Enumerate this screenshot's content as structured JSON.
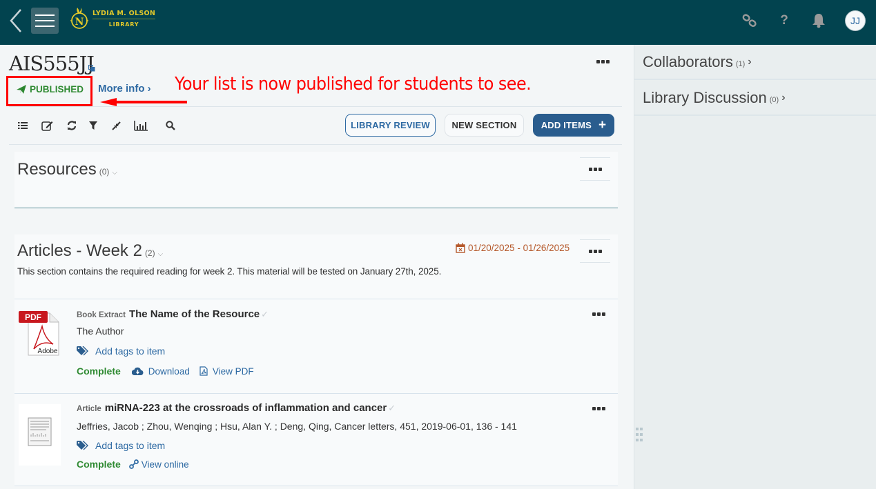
{
  "topbar": {
    "logo": {
      "line1": "LYDIA M. OLSON",
      "line2": "LIBRARY"
    },
    "icons": [
      "back-icon",
      "hamburger-menu-icon",
      "link-icon",
      "help-icon",
      "bell-icon"
    ],
    "avatar_initials": "JJ",
    "help_glyph": "?"
  },
  "list": {
    "title": "AIS555JJ",
    "status": "PUBLISHED",
    "more_info": "More info",
    "more_info_chevron": "›",
    "annotation": "Your list is now published for students to see."
  },
  "toolbar": {
    "icons": [
      "list-view-icon",
      "edit-icon",
      "refresh-icon",
      "filter-icon",
      "collapse-icon",
      "analytics-icon",
      "search-icon"
    ],
    "library_review": "LIBRARY REVIEW",
    "new_section": "NEW SECTION",
    "add_items": "ADD ITEMS",
    "add_items_icon": "+"
  },
  "sections": [
    {
      "title": "Resources",
      "count": "(0)",
      "chevron": "⌵"
    },
    {
      "title": "Articles - Week 2",
      "count": "(2)",
      "chevron": "⌵",
      "date_range": "01/20/2025 - 01/26/2025",
      "description": "This section contains the required reading for week 2. This material will be tested on January 27th, 2025.",
      "items": [
        {
          "type": "Book Extract",
          "title": "The Name of the Resource",
          "author": "The Author",
          "tags_label": "Add tags to item",
          "status": "Complete",
          "actions": [
            "Download",
            "View PDF"
          ],
          "thumb_label": "PDF",
          "thumb_brand": "Adobe"
        },
        {
          "type": "Article",
          "title": "miRNA-223 at the crossroads of inflammation and cancer",
          "citation": "Jeffries, Jacob ; Zhou, Wenqing ; Hsu, Alan Y. ; Deng, Qing, Cancer letters, 451, 2019-06-01, 136 - 141",
          "tags_label": "Add tags to item",
          "status": "Complete",
          "actions": [
            "View online"
          ]
        }
      ]
    }
  ],
  "sidebar": {
    "items": [
      {
        "label": "Collaborators",
        "count": "(1)",
        "chevron": "›"
      },
      {
        "label": "Library Discussion",
        "count": "(0)",
        "chevron": "›"
      }
    ]
  },
  "colors": {
    "topbar": "#02434f",
    "accent_blue": "#2e6aa3",
    "primary_button": "#2a5d8e",
    "published_green": "#2f8a32",
    "date_orange": "#b5582a",
    "annotation_red": "#ff0000",
    "logo_gold": "#e3c92a"
  }
}
